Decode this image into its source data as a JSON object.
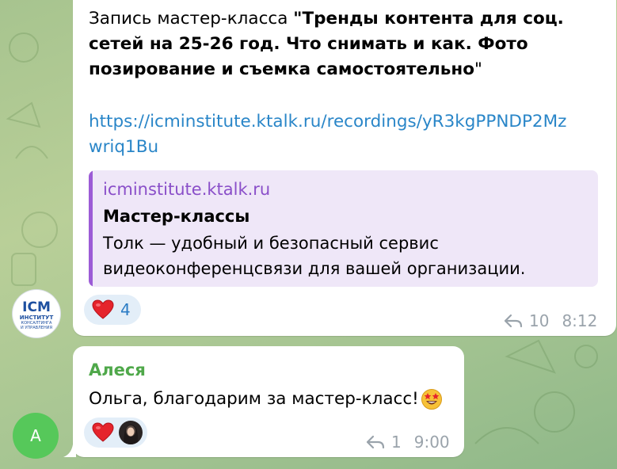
{
  "message1": {
    "text_prefix": "Запись мастер-класса ",
    "text_bold_line1": "\"Тренды контента для соц.",
    "text_bold_line2": "сетей на 25-26 год. Что снимать и как. Фото",
    "text_bold_line3": "позирование и съемка самостоятельно",
    "text_suffix": "\"",
    "link_line1": "https://icminstitute.ktalk.ru/recordings/yR3kgPPNDP2Mz",
    "link_line2": "wriq1Bu",
    "preview": {
      "site": "icminstitute.ktalk.ru",
      "title": "Мастер-классы",
      "description_line1": "Толк — удобный и безопасный сервис",
      "description_line2": "видеоконференцсвязи для вашей организации."
    },
    "reaction": {
      "emoji": "heart",
      "count": "4"
    },
    "replies": "10",
    "time": "8:12",
    "avatar": {
      "line1": "ICM",
      "line2": "ИНСТИТУТ",
      "line3": "КОНСАЛТИНГА",
      "line4": "И УПРАВЛЕНИЯ"
    }
  },
  "message2": {
    "sender": "Алеся",
    "text": "Ольга, благодарим за мастер-класс!",
    "emoji": "star-struck",
    "reaction": {
      "emoji": "heart"
    },
    "replies": "1",
    "time": "9:00",
    "avatar": {
      "letter": "A",
      "color": "#56c85a"
    }
  },
  "colors": {
    "link": "#2a86c8",
    "preview_accent": "#9c5bd6",
    "sender_name": "#4fa84a",
    "reaction_bg": "#e3eef8"
  }
}
